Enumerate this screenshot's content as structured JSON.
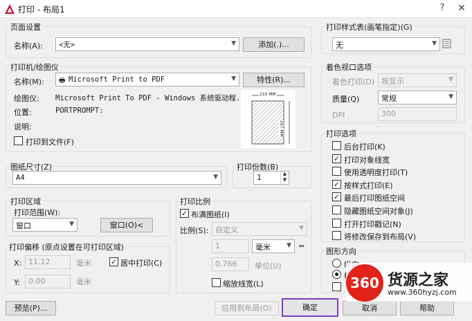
{
  "window": {
    "title": "打印 - 布局1",
    "help": "?",
    "close": "✕"
  },
  "page_setup": {
    "legend": "页面设置",
    "name_label": "名称(A):",
    "name_value": "<无>",
    "add_button": "添加(.)..."
  },
  "printer": {
    "legend": "打印机/绘图仪",
    "name_label": "名称(M):",
    "name_value": "Microsoft Print to PDF",
    "properties_button": "特性(R)...",
    "plotter_label": "绘图仪:",
    "plotter_value": "Microsoft Print To PDF - Windows 系统驱动程...",
    "location_label": "位置:",
    "location_value": "PORTPROMPT:",
    "description_label": "说明:",
    "print_to_file_label": "打印到文件(F)",
    "print_to_file_checked": false,
    "preview_width_label": "210 MM",
    "preview_height_label": "297 MM"
  },
  "paper_size": {
    "legend": "图纸尺寸(Z)",
    "value": "A4"
  },
  "copies": {
    "legend": "打印份数(B)",
    "value": "1"
  },
  "print_area": {
    "legend": "打印区域",
    "range_label": "打印范围(W):",
    "range_value": "窗口",
    "window_button": "窗口(O)<"
  },
  "print_offset": {
    "legend": "打印偏移 (原点设置在可打印区域)",
    "x_label": "X:",
    "x_value": "11.12",
    "x_unit": "毫米",
    "y_label": "Y:",
    "y_value": "0.00",
    "y_unit": "毫米",
    "center_label": "居中打印(C)",
    "center_checked": true
  },
  "print_scale": {
    "legend": "打印比例",
    "fit_label": "布满图纸(I)",
    "fit_checked": true,
    "scale_label": "比例(S):",
    "scale_value": "自定义",
    "value1": "1",
    "unit_value": "毫米",
    "equals": "=",
    "value2": "0.766",
    "unit_label": "单位(U)",
    "lineweight_label": "缩放线宽(L)",
    "lineweight_checked": false
  },
  "plot_style": {
    "legend": "打印样式表(画笔指定)(G)",
    "value": "无"
  },
  "shaded": {
    "legend": "着色视口选项",
    "shade_label": "着色打印(D)",
    "shade_value": "按显示",
    "quality_label": "质量(Q)",
    "quality_value": "常规",
    "dpi_label": "DPI",
    "dpi_value": "300"
  },
  "options": {
    "legend": "打印选项",
    "items": [
      {
        "label": "后台打印(K)",
        "checked": false
      },
      {
        "label": "打印对象线宽",
        "checked": true
      },
      {
        "label": "使用透明度打印(T)",
        "checked": false
      },
      {
        "label": "按样式打印(E)",
        "checked": true
      },
      {
        "label": "最后打印图纸空间",
        "checked": true
      },
      {
        "label": "隐藏图纸空间对象(J)",
        "checked": false
      },
      {
        "label": "打开打印戳记(N)",
        "checked": false
      },
      {
        "label": "将修改保存到布局(V)",
        "checked": false
      }
    ]
  },
  "orientation": {
    "legend": "图形方向",
    "portrait_label": "纵向",
    "landscape_label": "横向"
  },
  "footer": {
    "preview_button": "预览(P)...",
    "apply_button": "应用到布局(O)",
    "ok_button": "确定",
    "cancel_button": "取消",
    "help_button": "帮助"
  },
  "watermark": {
    "logo": "360",
    "title": "货源之家",
    "url": "www.360hyzj.com"
  },
  "colors": {
    "accent_border": "#7a3fbf",
    "watermark_red": "#e2231a",
    "app_icon_red": "#c8102e"
  }
}
